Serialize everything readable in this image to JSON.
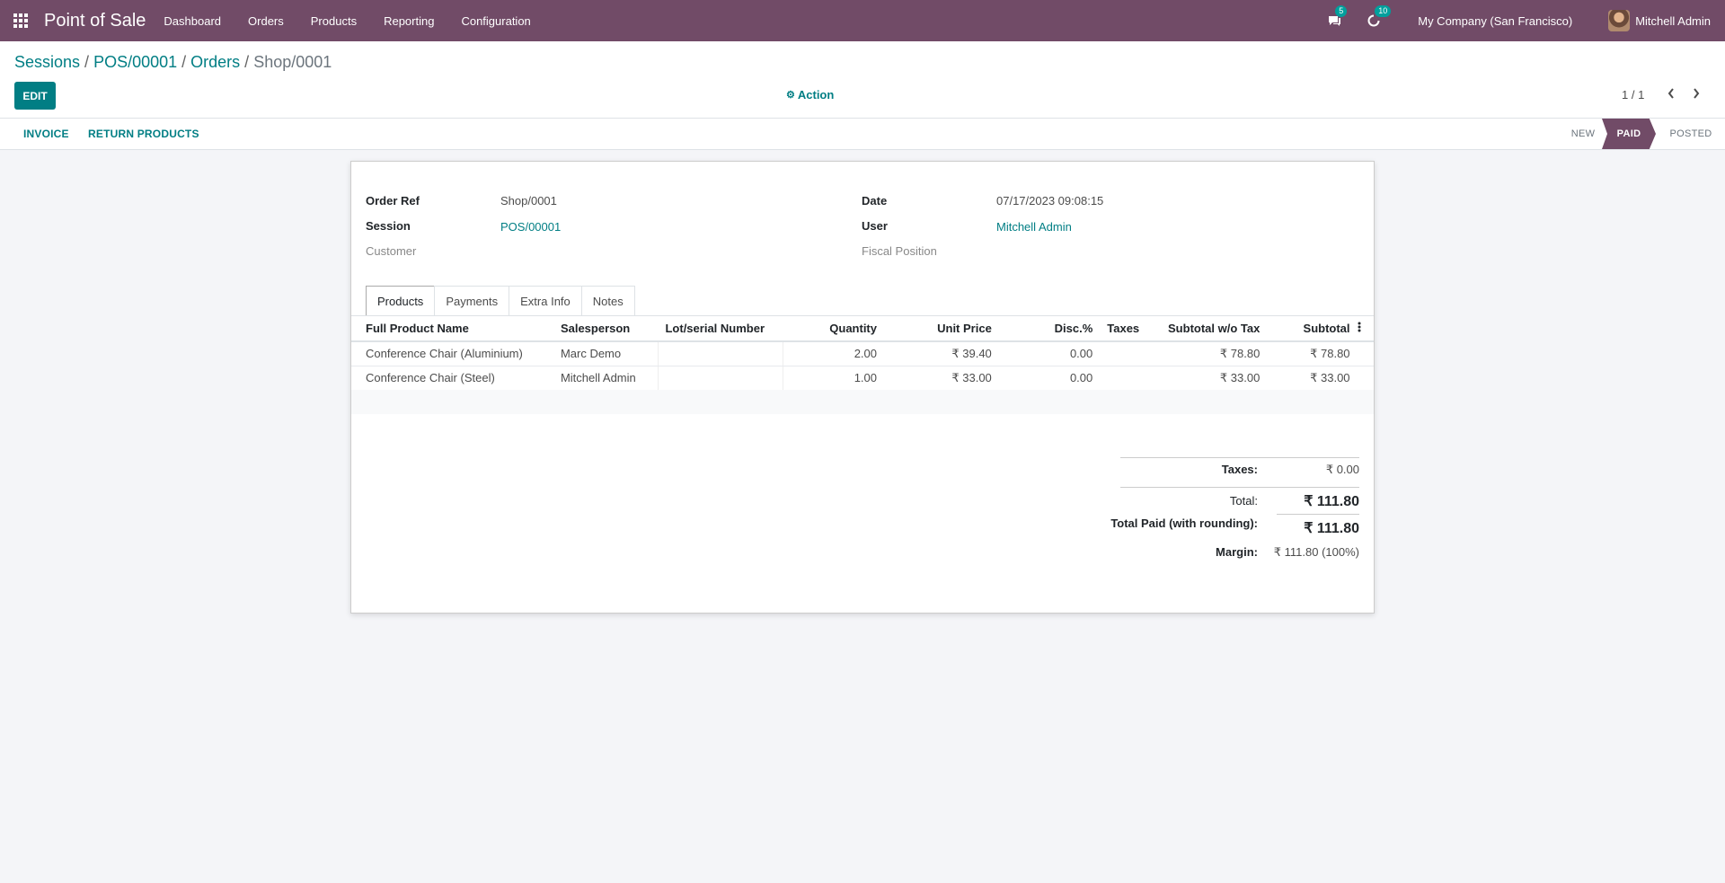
{
  "navbar": {
    "app_title": "Point of Sale",
    "menu": [
      "Dashboard",
      "Orders",
      "Products",
      "Reporting",
      "Configuration"
    ],
    "messages_badge": "5",
    "activities_badge": "10",
    "company": "My Company (San Francisco)",
    "user": "Mitchell Admin",
    "bg_color": "#714b67"
  },
  "breadcrumb": [
    "Sessions",
    "POS/00001",
    "Orders",
    "Shop/0001"
  ],
  "control": {
    "edit_label": "EDIT",
    "action_label": "Action",
    "pager": "1 / 1"
  },
  "statusbar": {
    "buttons": [
      "INVOICE",
      "RETURN PRODUCTS"
    ],
    "stages": [
      "NEW",
      "PAID",
      "POSTED"
    ],
    "active_stage": "PAID"
  },
  "form": {
    "order_ref_label": "Order Ref",
    "order_ref": "Shop/0001",
    "session_label": "Session",
    "session": "POS/00001",
    "customer_label": "Customer",
    "date_label": "Date",
    "date": "07/17/2023 09:08:15",
    "user_label": "User",
    "user": "Mitchell Admin",
    "fiscal_label": "Fiscal Position"
  },
  "tabs": [
    "Products",
    "Payments",
    "Extra Info",
    "Notes"
  ],
  "lines": {
    "headers": [
      "Full Product Name",
      "Salesperson",
      "Lot/serial Number",
      "Quantity",
      "Unit Price",
      "Disc.%",
      "Taxes",
      "Subtotal w/o Tax",
      "Subtotal"
    ],
    "rows": [
      [
        "Conference Chair (Aluminium)",
        "Marc Demo",
        "",
        "2.00",
        "₹ 39.40",
        "0.00",
        "",
        "₹ 78.80",
        "₹ 78.80"
      ],
      [
        "Conference Chair (Steel)",
        "Mitchell Admin",
        "",
        "1.00",
        "₹ 33.00",
        "0.00",
        "",
        "₹ 33.00",
        "₹ 33.00"
      ]
    ]
  },
  "totals": {
    "taxes_label": "Taxes:",
    "taxes": "₹ 0.00",
    "total_label": "Total:",
    "total": "₹ 111.80",
    "paid_label": "Total Paid (with rounding):",
    "paid": "₹ 111.80",
    "margin_label": "Margin:",
    "margin": "₹ 111.80 (100%)"
  }
}
